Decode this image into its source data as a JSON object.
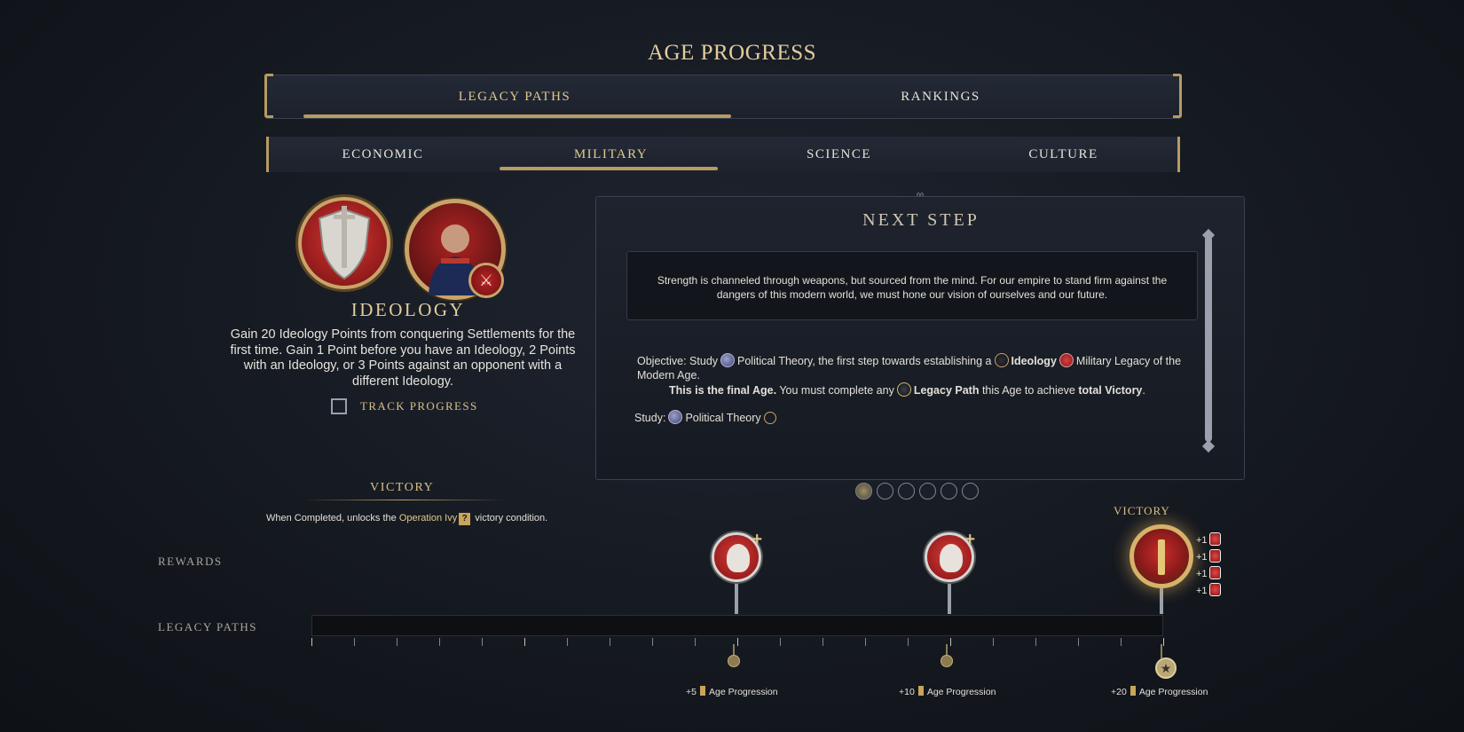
{
  "page": {
    "title": "AGE PROGRESS"
  },
  "main_tabs": [
    {
      "label": "LEGACY PATHS",
      "active": true
    },
    {
      "label": "RANKINGS",
      "active": false
    }
  ],
  "sub_tabs": [
    {
      "label": "ECONOMIC",
      "active": false
    },
    {
      "label": "MILITARY",
      "active": true
    },
    {
      "label": "SCIENCE",
      "active": false
    },
    {
      "label": "CULTURE",
      "active": false
    }
  ],
  "legacy": {
    "title": "IDEOLOGY",
    "description": "Gain 20 Ideology Points from conquering Settlements for the first time. Gain 1 Point before you have an Ideology, 2 Points with an Ideology, or 3 Points against an opponent with a different Ideology.",
    "track_label": "TRACK PROGRESS",
    "track_checked": false
  },
  "next_step": {
    "title": "NEXT STEP",
    "quote": "Strength is channeled through weapons, but sourced from the mind. For our empire to stand firm against the dangers of this modern world, we must hone our vision of ourselves and our future.",
    "objective_prefix": "Objective: Study",
    "objective_tech": "Political Theory",
    "objective_mid": ", the first step towards establishing a",
    "objective_ideology": "Ideology",
    "objective_suffix": "Military Legacy of the Modern Age.",
    "final_bold": "This is the final Age.",
    "final_mid": "You must complete any",
    "final_legacy": "Legacy Path",
    "final_mid2": "this Age to achieve",
    "final_victory": "total Victory",
    "final_end": ".",
    "study_prefix": "Study:",
    "study_tech": "Political Theory",
    "pages": 6,
    "active_page": 1
  },
  "victory": {
    "label": "VICTORY",
    "desc_prefix": "When Completed, unlocks the",
    "desc_link": "Operation Ivy",
    "desc_qmark": "?",
    "desc_suffix": "victory condition."
  },
  "timeline": {
    "rewards_label": "REWARDS",
    "legacy_label": "LEGACY PATHS",
    "progress": 0,
    "max": 20,
    "victory_label": "VICTORY",
    "bonuses": [
      "+1",
      "+1",
      "+1",
      "+1"
    ],
    "milestones": [
      {
        "amount": "+5",
        "text": "Age Progression"
      },
      {
        "amount": "+10",
        "text": "Age Progression"
      },
      {
        "amount": "+20",
        "text": "Age Progression"
      }
    ]
  },
  "colors": {
    "accent_gold": "#d9c08a",
    "military_red": "#9c1e1e",
    "background": "#151920"
  }
}
